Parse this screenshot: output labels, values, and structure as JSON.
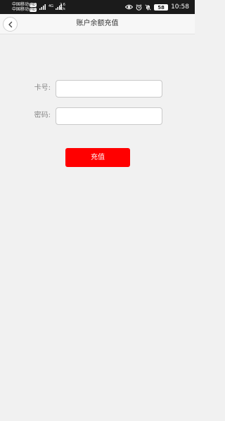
{
  "status_bar": {
    "carrier_1": "中国移动",
    "carrier_1_badge": "HD",
    "carrier_2": "中国移动",
    "carrier_2_badge": "HD",
    "network_type": "4G",
    "speed_value": "2.6",
    "speed_unit": "K/s",
    "battery_level": "58",
    "time": "10:58"
  },
  "header": {
    "title": "账户余额充值"
  },
  "form": {
    "card_label": "卡号:",
    "card_value": "",
    "password_label": "密码:",
    "password_value": ""
  },
  "actions": {
    "recharge_label": "充值",
    "recharge_color": "#ff0000"
  }
}
